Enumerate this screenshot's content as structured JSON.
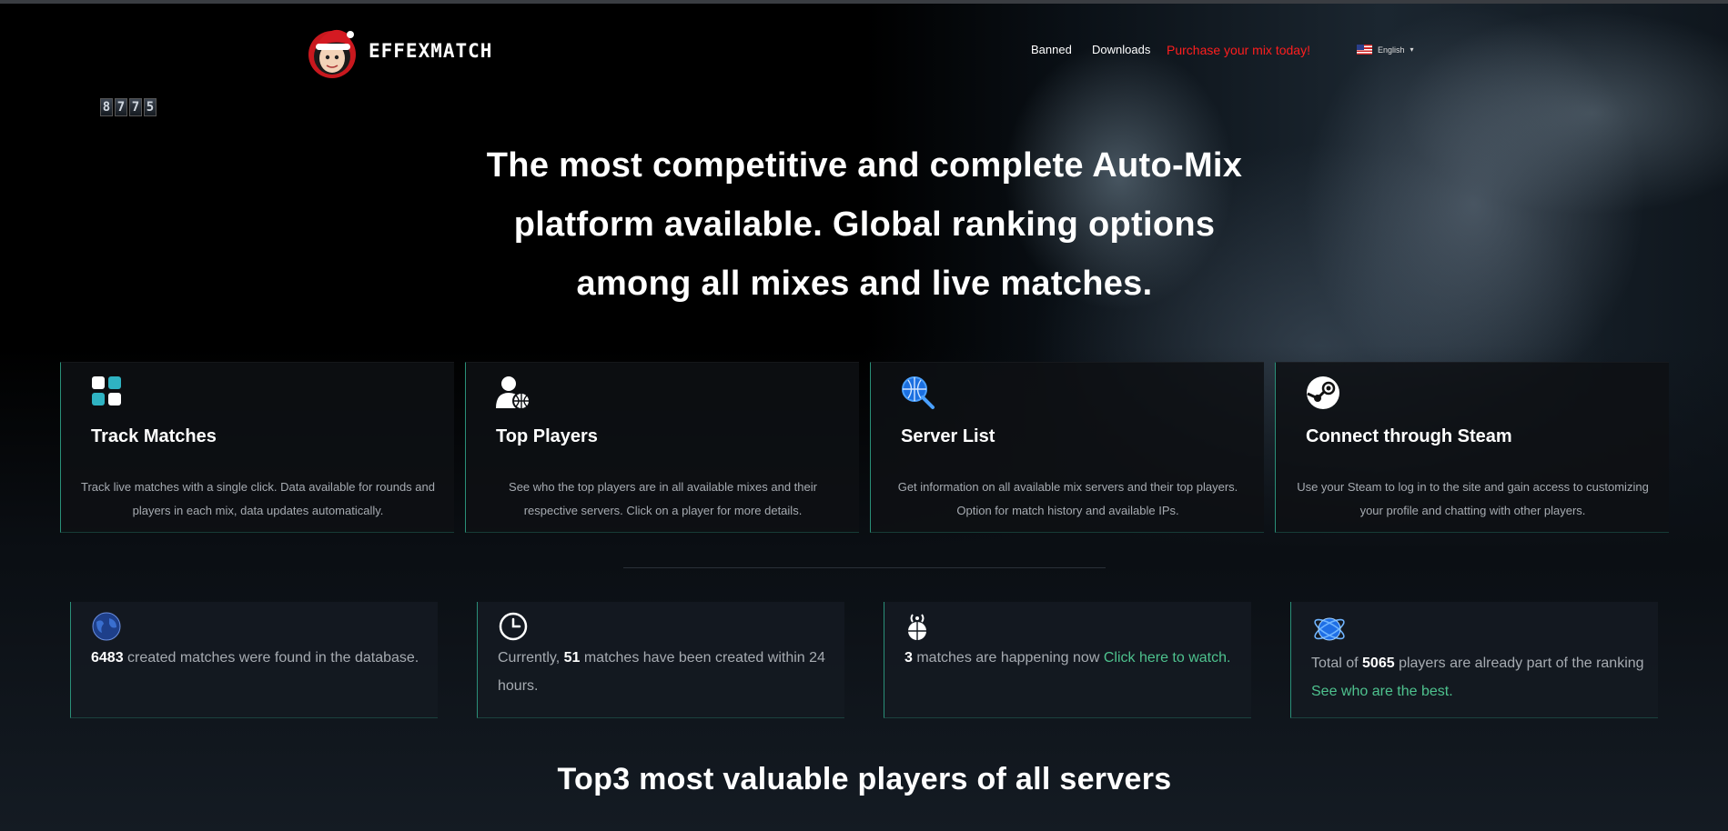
{
  "header": {
    "logo_text": "EFFEXMATCH",
    "nav": {
      "banned": "Banned",
      "downloads": "Downloads",
      "purchase": "Purchase your mix today!"
    },
    "language": "English"
  },
  "counter": [
    "8",
    "7",
    "7",
    "5"
  ],
  "hero": {
    "headline": "The most competitive and complete Auto-Mix platform available. Global ranking options among all mixes and live matches."
  },
  "features": [
    {
      "icon": "dashboard-icon",
      "title": "Track Matches",
      "description": "Track live matches with a single click. Data available for rounds and players in each mix, data updates automatically."
    },
    {
      "icon": "user-globe-icon",
      "title": "Top Players",
      "description": "See who the top players are in all available mixes and their respective servers. Click on a player for more details."
    },
    {
      "icon": "globe-search-icon",
      "title": "Server List",
      "description": "Get information on all available mix servers and their top players. Option for match history and available IPs."
    },
    {
      "icon": "steam-icon",
      "title": "Connect through Steam",
      "description": "Use your Steam to log in to the site and gain access to customizing your profile and chatting with other players."
    }
  ],
  "stats": {
    "created": {
      "value": "6483",
      "text": " created matches were found in the database."
    },
    "recent": {
      "prefix": "Currently, ",
      "value": "51",
      "text": " matches have been created within 24 hours."
    },
    "live": {
      "value": "3",
      "text": " matches are happening now ",
      "link": "Click here to watch."
    },
    "players": {
      "prefix": "Total of ",
      "value": "5065",
      "text": " players are already part of the ranking ",
      "link": "See who are the best."
    }
  },
  "section_title": "Top3 most valuable players of all servers",
  "colors": {
    "accent": "#4ec28e",
    "purchase": "#ff1e1e",
    "muted_text": "#a6abb1"
  }
}
